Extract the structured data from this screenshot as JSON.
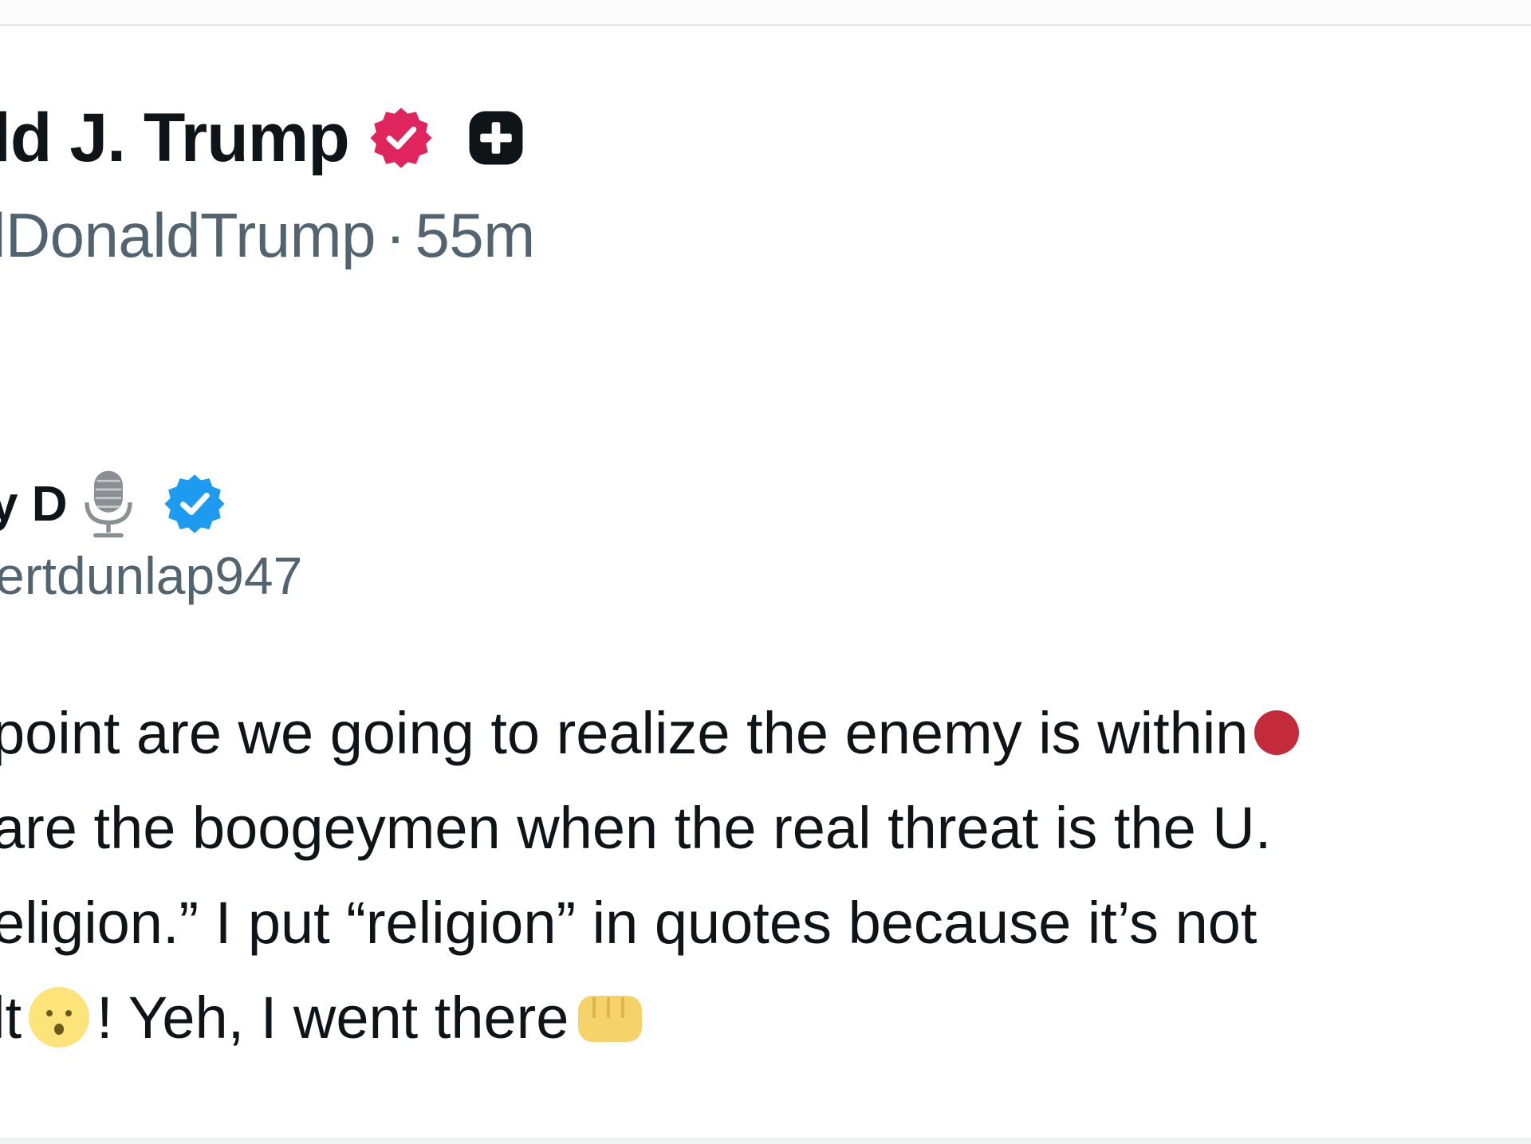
{
  "post": {
    "display_name": "ld J. Trump",
    "handle": "lDonaldTrump",
    "separator": "·",
    "timestamp": "55m",
    "badges": [
      "verified-check-badge",
      "plus-square-badge"
    ],
    "badge_color": "#e0245e"
  },
  "quoted_post": {
    "display_name": "y D",
    "handle": "ertdunlap947",
    "badges": [
      "microphone-icon",
      "verified-check-badge"
    ],
    "badge_color": "#1d9bf0",
    "body_lines": [
      " point are we going to realize the enemy is within",
      " are the boogeymen when the real threat is the U.",
      "eligion.” I put “religion” in quotes because it’s not",
      "lt",
      "! Yeh, I went there"
    ],
    "inline_icons": [
      "red-circle-icon",
      "face-emoji-icon",
      "fist-emoji-icon"
    ]
  }
}
